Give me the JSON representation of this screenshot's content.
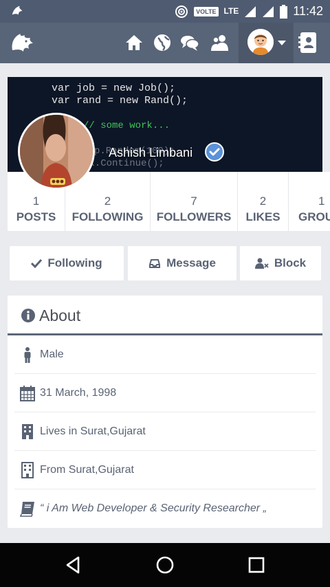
{
  "status_bar": {
    "volte": "VOLTE",
    "lte": "LTE",
    "time": "11:42"
  },
  "navbar": {
    "icons": [
      "home-icon",
      "globe-icon",
      "chat-icon",
      "users-icon",
      "user-avatar",
      "contacts-icon"
    ]
  },
  "cover": {
    "code_lines": [
      "var job = new Job();",
      "var rand = new Rand();",
      "// some work...",
      "p.Random(100);",
      "rk.Continue();"
    ]
  },
  "profile": {
    "name": "Ashish Limbani",
    "verified": true
  },
  "stats": [
    {
      "count": "1",
      "label": "POSTS"
    },
    {
      "count": "2",
      "label": "FOLLOWING"
    },
    {
      "count": "7",
      "label": "FOLLOWERS"
    },
    {
      "count": "2",
      "label": "LIKES"
    },
    {
      "count": "1",
      "label": "GROU"
    }
  ],
  "actions": {
    "following": "Following",
    "message": "Message",
    "block": "Block"
  },
  "about": {
    "title": "About",
    "gender": "Male",
    "birthday": "31 March, 1998",
    "lives_in": "Lives in Surat,Gujarat",
    "from": "From Surat,Gujarat",
    "bio": "“ i Am Web Developer & Security Researcher „"
  },
  "colors": {
    "status_bar": "#4f5b71",
    "navbar": "#586477",
    "background": "#e9ebee",
    "accent_blue": "#5b92d8",
    "text": "#5a6374"
  }
}
